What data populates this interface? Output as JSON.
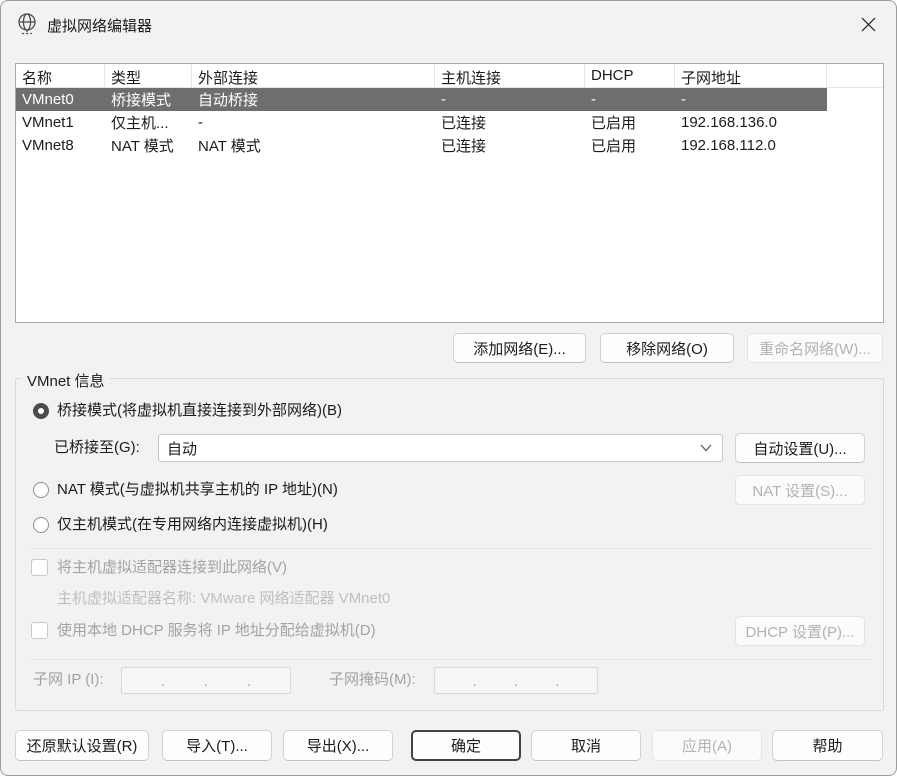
{
  "window": {
    "title": "虚拟网络编辑器"
  },
  "icons": {
    "app_icon": "network-globe",
    "close_icon": "close-x",
    "combo_chevron": "chevron-down"
  },
  "colors": {
    "selection_bg": "#6E6E6E",
    "selection_text": "#FFFFFF",
    "disabled_text": "#A3A3A3",
    "note_text": "#C0C0C0",
    "default_button_border": "#424242"
  },
  "table": {
    "columns": [
      "名称",
      "类型",
      "外部连接",
      "主机连接",
      "DHCP",
      "子网地址"
    ],
    "rows": [
      {
        "cells": [
          "VMnet0",
          "桥接模式",
          "自动桥接",
          "-",
          "-",
          "-"
        ],
        "selected": true
      },
      {
        "cells": [
          "VMnet1",
          "仅主机...",
          "-",
          "已连接",
          "已启用",
          "192.168.136.0"
        ],
        "selected": false
      },
      {
        "cells": [
          "VMnet8",
          "NAT 模式",
          "NAT 模式",
          "已连接",
          "已启用",
          "192.168.112.0"
        ],
        "selected": false
      }
    ]
  },
  "actions": {
    "add": "添加网络(E)...",
    "remove": "移除网络(O)",
    "rename": "重命名网络(W)..."
  },
  "vmnet_info": {
    "group_label": "VMnet 信息",
    "bridged_radio": "桥接模式(将虚拟机直接连接到外部网络)(B)",
    "bridged_to_label": "已桥接至(G):",
    "bridged_to_value": "自动",
    "auto_settings": "自动设置(U)...",
    "nat_radio": "NAT 模式(与虚拟机共享主机的 IP 地址)(N)",
    "nat_settings": "NAT 设置(S)...",
    "hostonly_radio": "仅主机模式(在专用网络内连接虚拟机)(H)",
    "connect_adapter_checkbox": "将主机虚拟适配器连接到此网络(V)",
    "adapter_name_note": "主机虚拟适配器名称: VMware 网络适配器 VMnet0",
    "dhcp_checkbox": "使用本地 DHCP 服务将 IP 地址分配给虚拟机(D)",
    "dhcp_settings": "DHCP 设置(P)...",
    "subnet_ip_label": "子网 IP (I):",
    "subnet_mask_label": "子网掩码(M):",
    "ip_dot": "."
  },
  "footer": {
    "restore": "还原默认设置(R)",
    "import": "导入(T)...",
    "export": "导出(X)...",
    "ok": "确定",
    "cancel": "取消",
    "apply": "应用(A)",
    "help": "帮助"
  }
}
